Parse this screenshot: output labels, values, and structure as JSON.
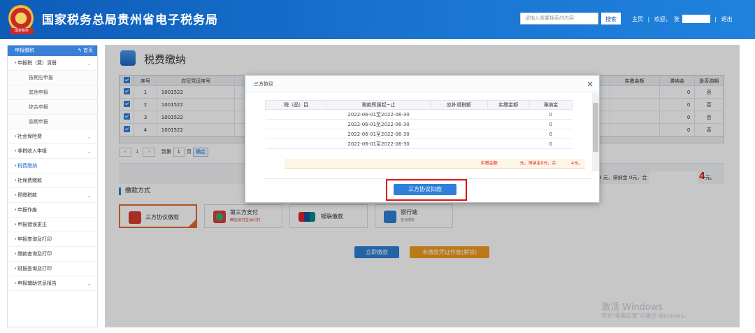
{
  "header": {
    "emblem_text": "国家税务",
    "title": "国家税务总局贵州省电子税务局",
    "search_placeholder": "请输入需要搜索的内容",
    "search_btn": "搜索",
    "home_link": "主页",
    "welcome": "欢迎，",
    "welcome_name": "张",
    "logout": "退出"
  },
  "sidebar": {
    "head": "申报缴税",
    "home": "首页",
    "items": [
      {
        "label": "申报税（费）清册",
        "sub": false,
        "chev": true
      },
      {
        "label": "按期应申报",
        "sub": true
      },
      {
        "label": "其他申报",
        "sub": true
      },
      {
        "label": "综合申报",
        "sub": true
      },
      {
        "label": "逾期申报",
        "sub": true
      },
      {
        "label": "社会保险费",
        "sub": false,
        "chev": true
      },
      {
        "label": "非税收入申报",
        "sub": false,
        "chev": true
      },
      {
        "label": "税费缴纳",
        "sub": false,
        "active": true
      },
      {
        "label": "社保费缴款",
        "sub": false
      },
      {
        "label": "预缴税款",
        "sub": false,
        "chev": true
      },
      {
        "label": "申报作废",
        "sub": false
      },
      {
        "label": "申报错误更正",
        "sub": false
      },
      {
        "label": "申报查询及打印",
        "sub": false
      },
      {
        "label": "缴款查询及打印",
        "sub": false
      },
      {
        "label": "财报查询及打印",
        "sub": false
      },
      {
        "label": "申报辅助信息报告",
        "sub": false,
        "chev": true
      }
    ]
  },
  "page": {
    "title": "税费缴纳"
  },
  "table": {
    "headers": [
      "序号",
      "应征凭证序号",
      "实缴金额",
      "滞纳金",
      "是否逾期"
    ],
    "rows": [
      {
        "no": "1",
        "ref": "1001522",
        "late": "0",
        "overdue": "否"
      },
      {
        "no": "2",
        "ref": "1001522",
        "late": "0",
        "overdue": "否"
      },
      {
        "no": "3",
        "ref": "1001522",
        "late": "0",
        "overdue": "否"
      },
      {
        "no": "4",
        "ref": "1001522",
        "late": "0",
        "overdue": "否"
      }
    ]
  },
  "pager": {
    "page": "1",
    "goto": "到第",
    "goto_page": "1",
    "page_unit": "页",
    "confirm": "确定"
  },
  "summary": {
    "text": "4 元，滞纳金 0元，合",
    "total": "4",
    "unit": "元。"
  },
  "payment": {
    "section_title": "缴款方式",
    "tri_label": "三方协议缴款",
    "third_label": "第三方支付",
    "third_sub": "微信/支付宝/云闪付",
    "union_label": "银联缴款",
    "bank_label": "银行端",
    "bank_sub": "查询缴款"
  },
  "actions": {
    "pay_now": "立即缴款",
    "void": "未缴款凭证作废(解锁)"
  },
  "modal": {
    "title": "三方协议",
    "headers": [
      "税（品）目",
      "税款所属起~止",
      "应补退税额",
      "实缴金额",
      "滞纳金"
    ],
    "rows": [
      {
        "period": "2022-06-01至2022-06-30",
        "late": "0"
      },
      {
        "period": "2022-06-01至2022-06-30",
        "late": "0"
      },
      {
        "period": "2022-06-01至2022-06-30",
        "late": "0"
      },
      {
        "period": "2022-06-01至2022-06-30",
        "late": "0"
      }
    ],
    "total_text": "实缴金额",
    "total_tail": "元，滞纳金0元，合",
    "total_end": "4元。",
    "button": "三方协议扣款"
  },
  "watermark": {
    "line1": "激活 Windows",
    "line2": "转到\"电脑设置\"以激活 Windows。"
  },
  "colors": {
    "header": "#1a76d2",
    "accent": "#2e7fd8",
    "highlight": "#e01010",
    "orange": "#f39a1e"
  }
}
